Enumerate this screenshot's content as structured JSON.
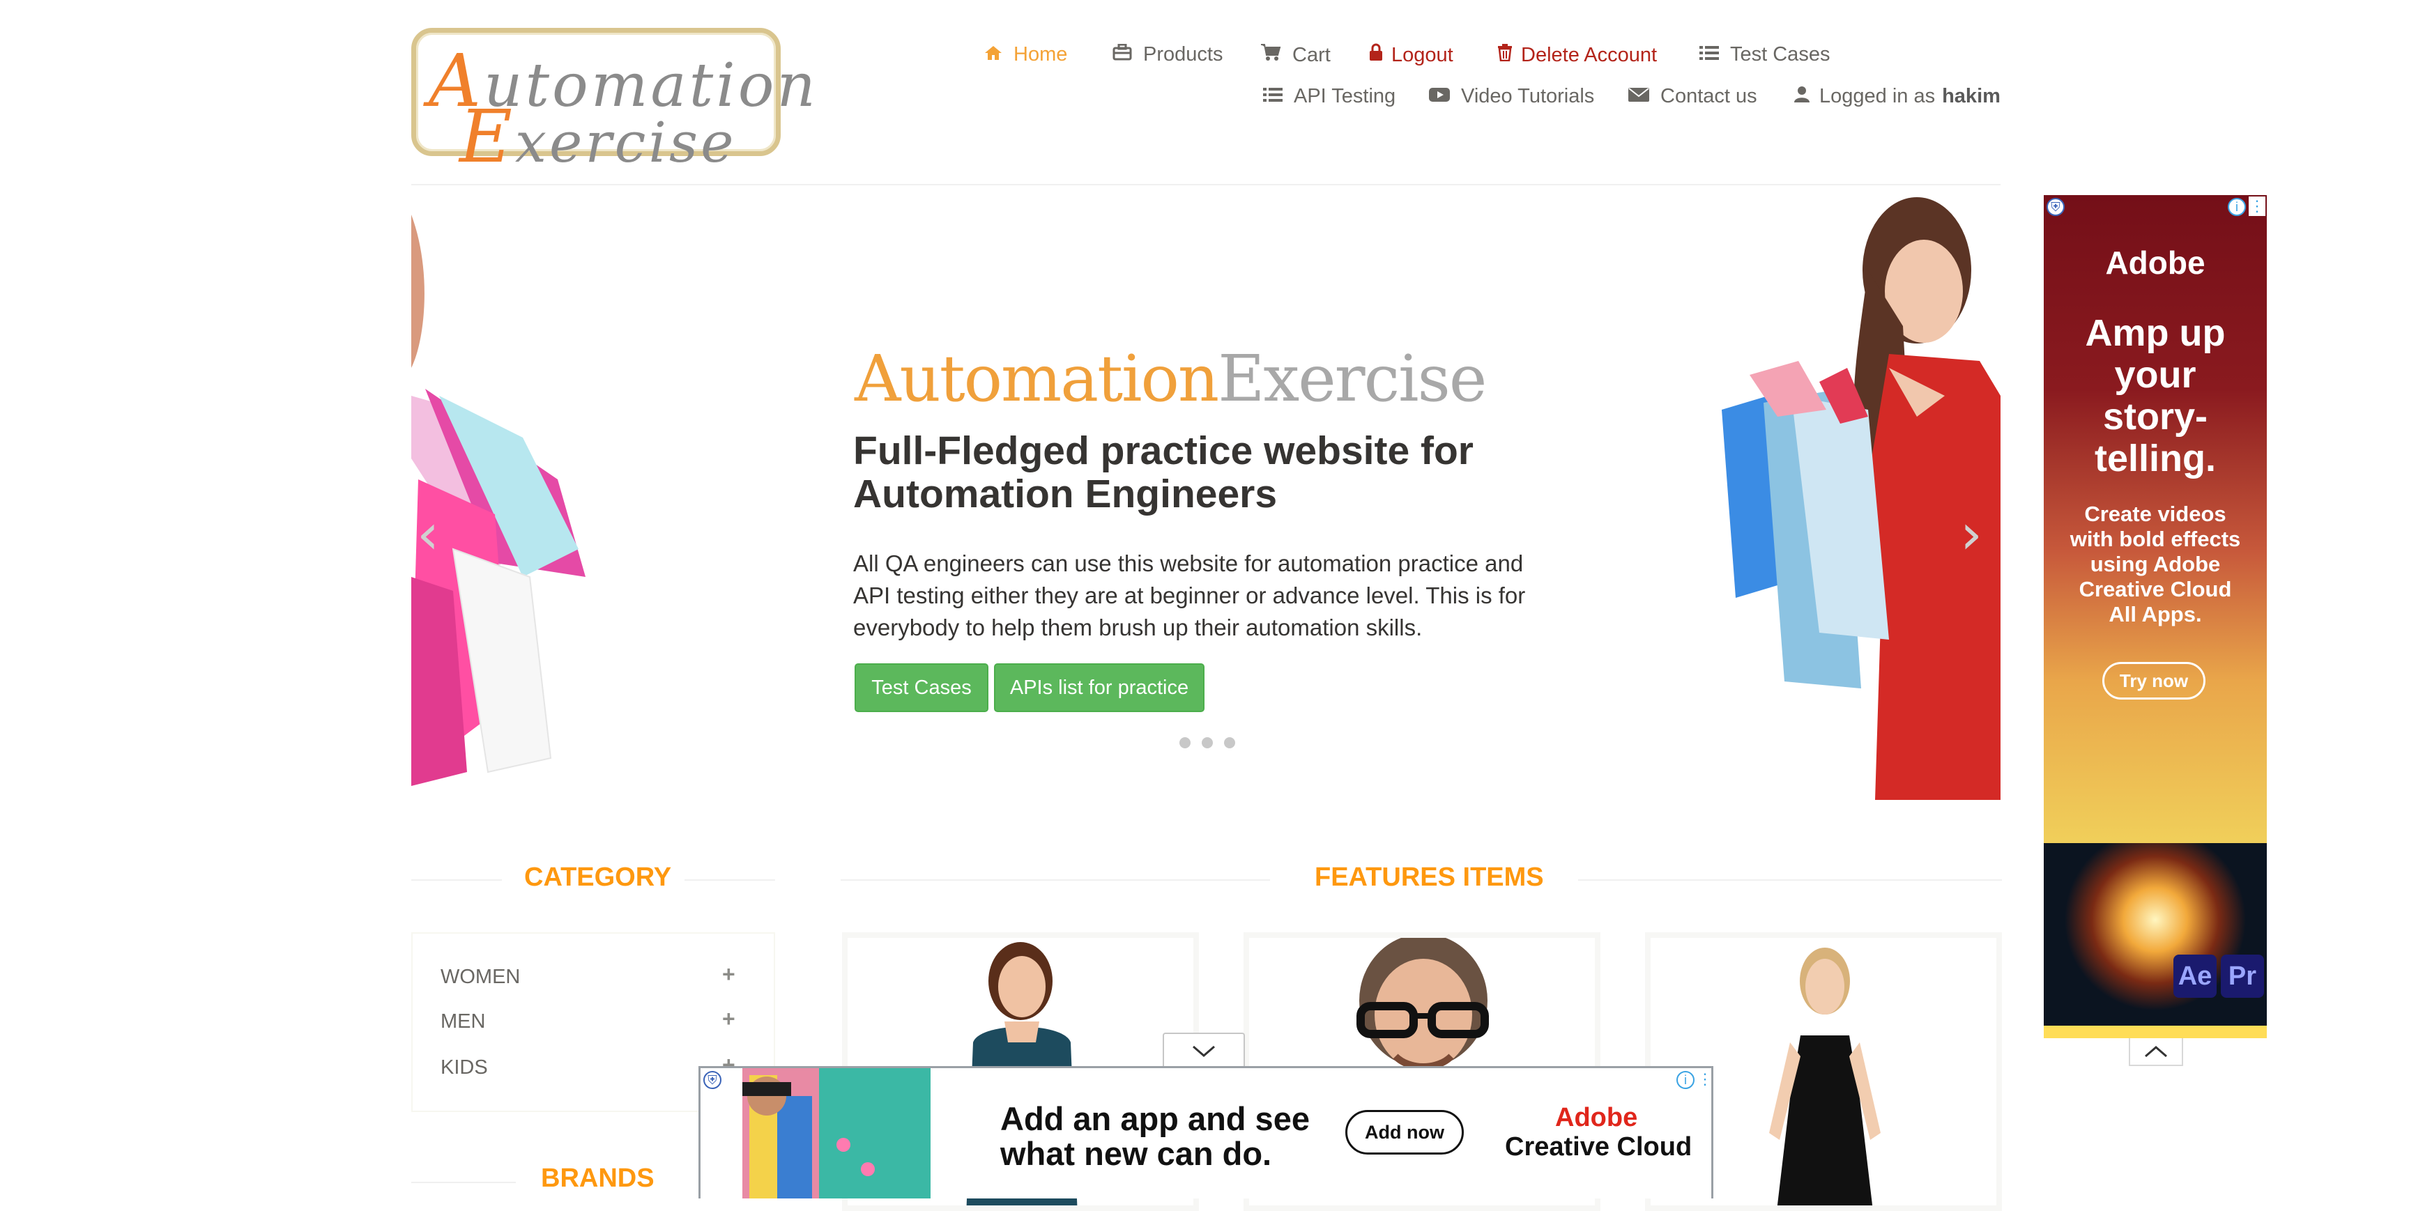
{
  "header": {
    "logo_line1_cap": "A",
    "logo_line1_rest": "utomation",
    "logo_line2_cap": "E",
    "logo_line2_rest": "xercise",
    "nav_row1": [
      {
        "label": "Home",
        "icon": "home-icon"
      },
      {
        "label": "Products",
        "icon": "briefcase-icon"
      },
      {
        "label": "Cart",
        "icon": "cart-icon"
      },
      {
        "label": "Logout",
        "icon": "lock-icon"
      },
      {
        "label": "Delete Account",
        "icon": "trash-icon"
      },
      {
        "label": "Test Cases",
        "icon": "list-icon"
      }
    ],
    "nav_row2": [
      {
        "label": "API Testing",
        "icon": "list-icon"
      },
      {
        "label": "Video Tutorials",
        "icon": "youtube-icon"
      },
      {
        "label": "Contact us",
        "icon": "envelope-icon"
      },
      {
        "label": "Logged in as",
        "icon": "user-icon",
        "username": "hakim"
      }
    ]
  },
  "slider": {
    "brand_orange": "Automation",
    "brand_gray": "Exercise",
    "heading": "Full-Fledged practice website for Automation Engineers",
    "text": "All QA engineers can use this website for automation practice and API testing either they are at beginner or advance level. This is for everybody to help them brush up their automation skills.",
    "btn_test_cases": "Test Cases",
    "btn_apis": "APIs list for practice",
    "dots": 3
  },
  "sidebar": {
    "category_title": "CATEGORY",
    "categories": [
      "WOMEN",
      "MEN",
      "KIDS"
    ],
    "brands_title": "BRANDS"
  },
  "main": {
    "features_title": "FEATURES ITEMS"
  },
  "ad_right": {
    "brand": "Adobe",
    "headline": "Amp up your story-telling.",
    "body": "Create videos with bold effects using Adobe Creative Cloud All Apps.",
    "cta": "Try now",
    "badges": [
      "Ae",
      "Pr"
    ]
  },
  "ad_bottom": {
    "line1": "Add an app and see",
    "line2": "what new can do.",
    "cta": "Add now",
    "brand1": "Adobe",
    "brand2": "Creative Cloud"
  },
  "colors": {
    "accent": "#fe980f",
    "green": "#5cb85c",
    "red_nav": "#b3241a",
    "adobe_red": "#740f18"
  }
}
